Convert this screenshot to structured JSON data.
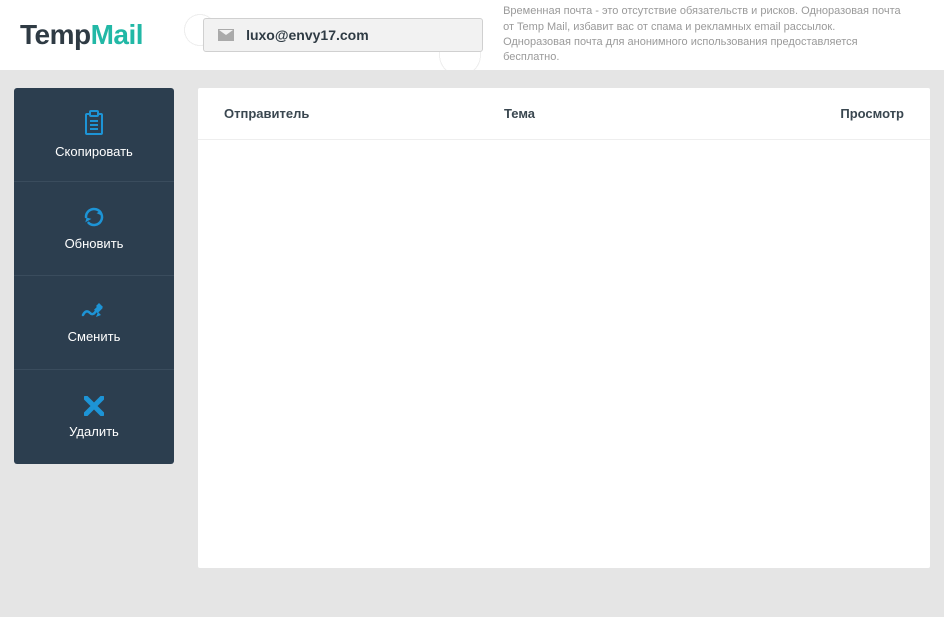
{
  "brand": {
    "part1": "Temp",
    "part2": "Mail"
  },
  "email": "luxo@envy17.com",
  "description": "Временная почта - это отсутствие обязательств и рисков. Одноразовая почта от Temp Mail, избавит вас от спама и рекламных email рассылок. Одноразовая почта для анонимного использования предоставляется бесплатно.",
  "sidebar": {
    "copy": "Скопировать",
    "refresh": "Обновить",
    "change": "Сменить",
    "delete": "Удалить"
  },
  "columns": {
    "sender": "Отправитель",
    "subject": "Тема",
    "view": "Просмотр"
  }
}
